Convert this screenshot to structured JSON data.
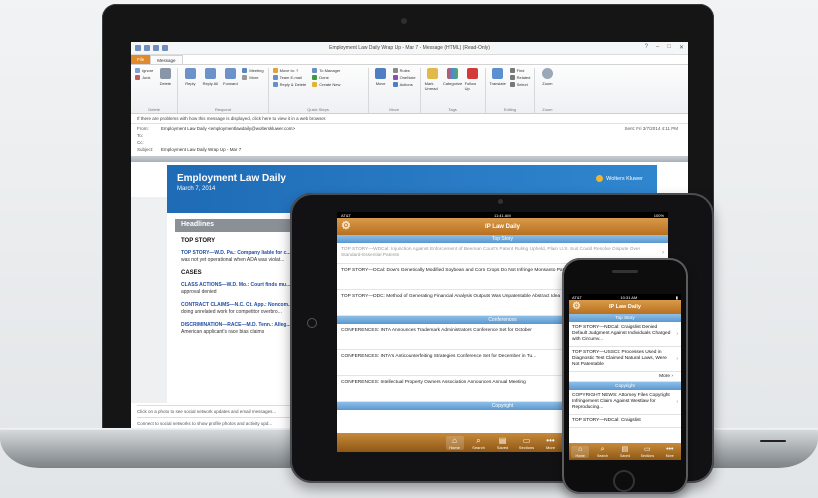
{
  "laptop": {
    "window_title": "Employment Law Daily Wrap Up - Mar 7 - Message (HTML) (Read-Only)",
    "tabs": [
      "File",
      "Message"
    ],
    "ribbon": {
      "delete": {
        "ignore": "Ignore",
        "junk": "Junk",
        "delete": "Delete"
      },
      "respond": {
        "reply": "Reply",
        "reply_all": "Reply All",
        "forward": "Forward",
        "meeting": "Meeting",
        "more": "More"
      },
      "quick_steps": [
        "Move to: ?",
        "Team E-mail",
        "Reply & Delete",
        "To Manager",
        "Done",
        "Create New"
      ],
      "move": {
        "move": "Move",
        "rules": "Rules",
        "onenote": "OneNote",
        "actions": "Actions"
      },
      "tags": {
        "mark_unread": "Mark Unread",
        "categorize": "Categorize",
        "follow_up": "Follow Up"
      },
      "editing": {
        "translate": "Translate",
        "find": "Find",
        "related": "Related",
        "select": "Select"
      },
      "zoom": "Zoom",
      "group_labels": [
        "Delete",
        "Respond",
        "Quick Steps",
        "Move",
        "Tags",
        "Editing",
        "Zoom"
      ]
    },
    "info_bar": "If there are problems with how this message is displayed, click here to view it in a web browser.",
    "header": {
      "from_label": "From:",
      "from_value": "Employment Law Daily <employmentlawdaily@wolterskluwer.com>",
      "to_label": "To:",
      "cc_label": "Cc:",
      "subject_label": "Subject:",
      "subject_value": "Employment Law Daily Wrap Up - Mar 7",
      "sent": "Sent: Fri 3/7/2014 4:11 PM"
    },
    "email": {
      "title": "Employment Law Daily",
      "date": "March 7, 2014",
      "brand": "Wolters Kluwer",
      "headlines": "Headlines",
      "top_story_heading": "TOP STORY",
      "top_story": "TOP STORY—W.D. Pa.: Company liable for c...",
      "top_story_rest": "was not yet operational when ADA was violat...",
      "cases_heading": "CASES",
      "items": [
        {
          "title": "CLASS ACTIONS—W.D. Mo.: Court finds mu...",
          "rest": "approval denied"
        },
        {
          "title": "CONTRACT CLAIMS—N.C. Ct. App.: Noncom...",
          "rest": "doing unrelated work for competitor overbro..."
        },
        {
          "title": "DISCRIMINATION—RACE—M.D. Tenn.: Alleg...",
          "rest": "American applicant's race bias claims"
        }
      ]
    },
    "footer_lines": [
      "Click on a photo to see social network updates and email messages...",
      "Connect to social networks to show profile photos and activity upd..."
    ]
  },
  "tablet": {
    "status_left": "AT&T",
    "status_time": "11:41 AM",
    "status_right": "100%",
    "title": "IP Law Daily",
    "sections": {
      "top_story": "Top Story",
      "conferences": "Conferences",
      "copyright": "Copyright"
    },
    "top_story_items": [
      "TOP STORY—WDCal: Injunction Against Enforcement of Beeman Court's Patent Ruling Upheld, Plain U.S. Suit Could Resolve Dispute Over Standard-Essential Patents",
      "TOP STORY—DCal: Dow's Genetically Modified Soybean and Corn Crops Do Not Infringe Monsanto Patent",
      "TOP STORY—DDC: Method of Generating Financial Analysis Outputs Was Unpatentable Abstract Idea"
    ],
    "conference_items": [
      "CONFERENCES: INTA Announces Trademark Administrators Conference Set for October",
      "CONFERENCES: INTA's Anticounterfeiting Strategies Conference Set for December in Tu...",
      "CONFERENCES: Intellectual Property Owners Association Announces Annual Meeting"
    ],
    "tabbar": [
      "Home",
      "Search",
      "Saved",
      "Sections",
      "More"
    ]
  },
  "phone": {
    "status_left": "AT&T",
    "status_time": "10:31 AM",
    "title": "IP Law Daily",
    "sections": {
      "top_story": "Top Story",
      "copyright": "Copyright"
    },
    "top_story_items": [
      "TOP STORY—NDCal: Craigslist Denied Default Judgment Against Individuals Charged with Circumv...",
      "TOP STORY—USSCt: Processes Used in Diagnostic Test Claimed Natural Laws, Were Not Patentable"
    ],
    "more": "More",
    "copyright_items": [
      "COPYRIGHT NEWS: Attorney Files Copyright Infringement Claim Against Westlaw for Reproducing...",
      "TOP STORY—NDCal: Craigslist"
    ],
    "tabbar": [
      "Home",
      "Search",
      "Saved",
      "Sections",
      "More"
    ]
  },
  "colors": {
    "outlook_file_tab": "#e08a2c",
    "email_header_blue": "#1f6bb5",
    "app_nav_orange": "#c07a28",
    "section_blue": "#6aa4d8"
  }
}
